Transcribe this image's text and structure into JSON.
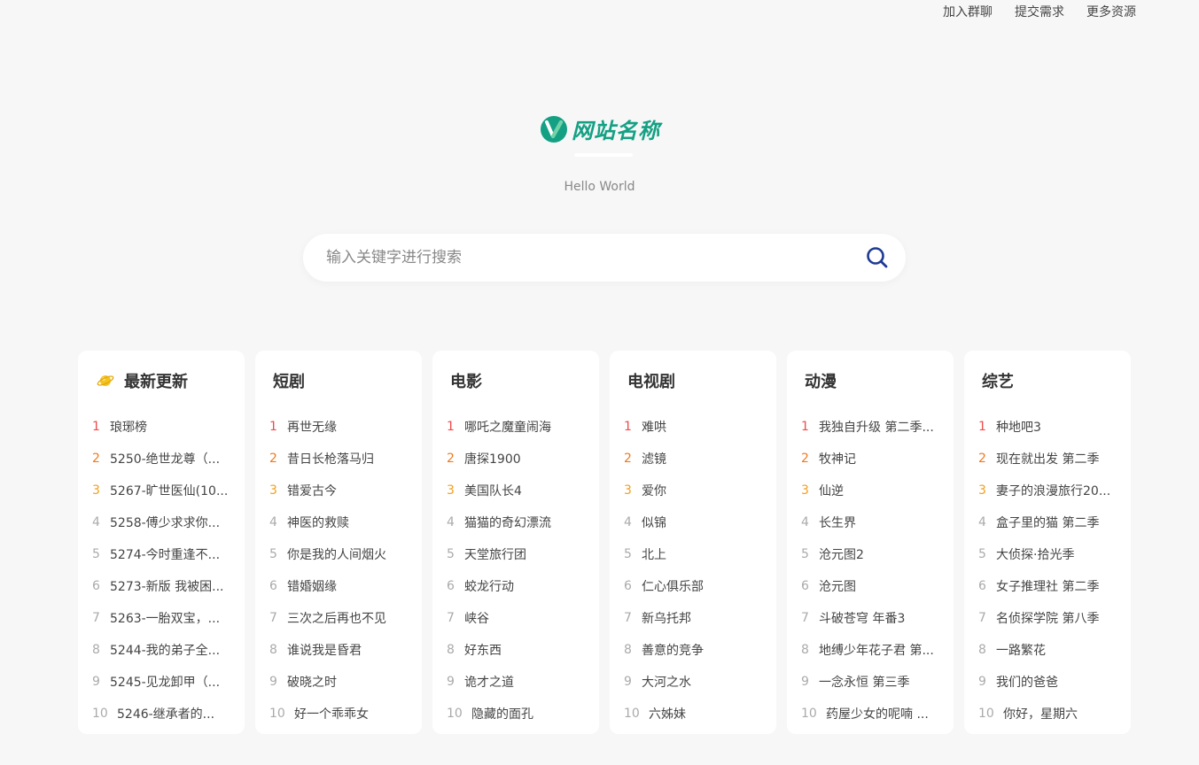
{
  "topnav": {
    "items": [
      "加入群聊",
      "提交需求",
      "更多资源"
    ]
  },
  "logo": {
    "text": "网站名称",
    "icon": "logo-mark-icon"
  },
  "tagline": "Hello World",
  "search": {
    "placeholder": "输入关键字进行搜索",
    "value": "",
    "icon": "search-icon"
  },
  "colors": {
    "brand": "#14a083",
    "rank1": "#f04b4b",
    "rank2": "#f07a1e",
    "rank3": "#f0a020",
    "search_icon": "#1f3a93"
  },
  "categories": [
    {
      "title": "最新更新",
      "icon": "planet-icon",
      "items": [
        "琅琊榜",
        "5250-绝世龙尊（...",
        "5267-旷世医仙(10...",
        "5258-傅少求求你...",
        "5274-今时重逢不...",
        "5273-新版 我被困...",
        "5263-一胎双宝，...",
        "5244-我的弟子全...",
        "5245-见龙卸甲（...",
        "5246-继承者的..."
      ]
    },
    {
      "title": "短剧",
      "items": [
        "再世无缘",
        "昔日长枪落马归",
        "错爱古今",
        "神医的救赎",
        "你是我的人间烟火",
        "错婚姻缘",
        "三次之后再也不见",
        "谁说我是昏君",
        "破晓之时",
        "好一个乖乖女"
      ]
    },
    {
      "title": "电影",
      "items": [
        "哪吒之魔童闹海",
        "唐探1900",
        "美国队长4",
        "猫猫的奇幻漂流",
        "天堂旅行团",
        "蛟龙行动",
        "峡谷",
        "好东西",
        "诡才之道",
        "隐藏的面孔"
      ]
    },
    {
      "title": "电视剧",
      "items": [
        "难哄",
        "滤镜",
        "爱你",
        "似锦",
        "北上",
        "仁心俱乐部",
        "新乌托邦",
        "善意的竞争",
        "大河之水",
        "六姊妹"
      ]
    },
    {
      "title": "动漫",
      "items": [
        "我独自升级 第二季...",
        "牧神记",
        "仙逆",
        "长生界",
        "沧元图2",
        "沧元图",
        "斗破苍穹 年番3",
        "地缚少年花子君 第...",
        "一念永恒 第三季",
        "药屋少女的呢喃 ..."
      ]
    },
    {
      "title": "综艺",
      "items": [
        "种地吧3",
        "现在就出发 第二季",
        "妻子的浪漫旅行20...",
        "盒子里的猫 第二季",
        "大侦探·拾光季",
        "女子推理社 第二季",
        "名侦探学院 第八季",
        "一路繁花",
        "我们的爸爸",
        "你好，星期六"
      ]
    }
  ]
}
